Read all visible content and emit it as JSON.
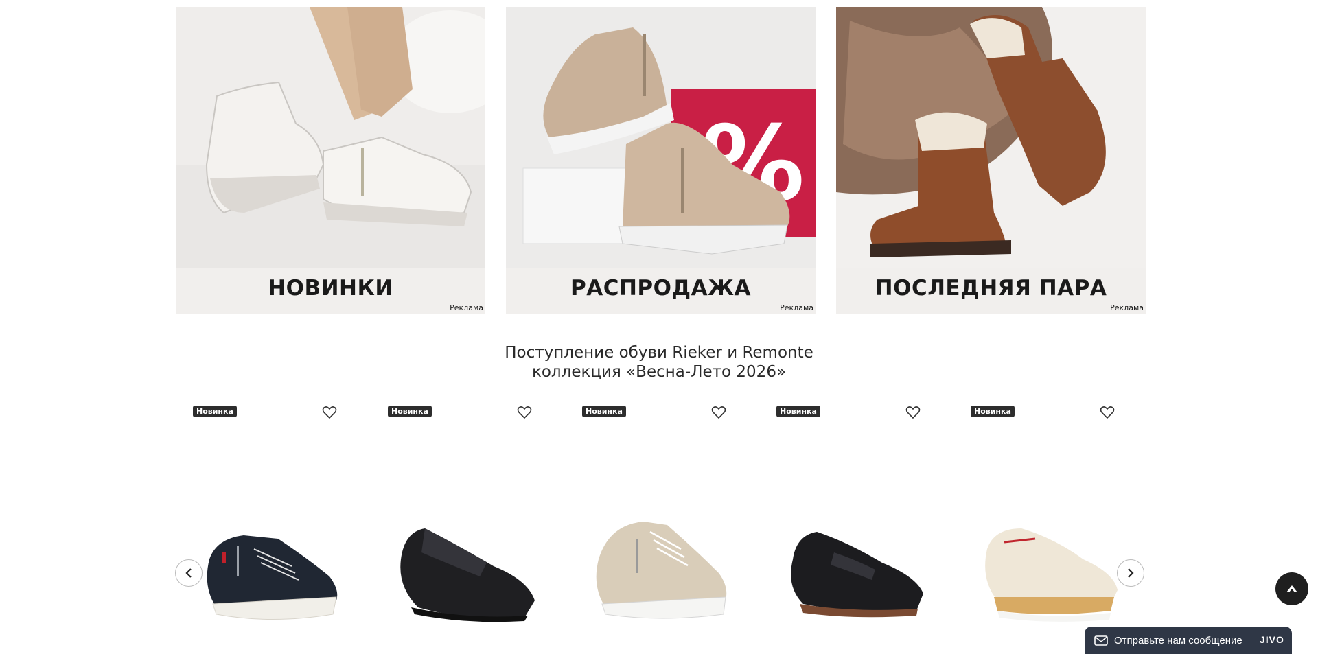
{
  "banners": [
    {
      "title": "НОВИНКИ",
      "ad_label": "Реклама"
    },
    {
      "title": "РАСПРОДАЖА",
      "ad_label": "Реклама"
    },
    {
      "title": "ПОСЛЕДНЯЯ ПАРА",
      "ad_label": "Реклама"
    }
  ],
  "section": {
    "title_line1": "Поступление обуви Rieker и Remonte",
    "title_line2": "коллекция «Весна-Лето 2026»"
  },
  "products": [
    {
      "badge": "Новинка",
      "icon": "heart-icon"
    },
    {
      "badge": "Новинка",
      "icon": "heart-icon"
    },
    {
      "badge": "Новинка",
      "icon": "heart-icon"
    },
    {
      "badge": "Новинка",
      "icon": "heart-icon"
    },
    {
      "badge": "Новинка",
      "icon": "heart-icon"
    }
  ],
  "chat": {
    "message": "Отправьте нам сообщение",
    "brand": "JIVO"
  },
  "colors": {
    "badge_bg": "#2d2d2d",
    "chat_bg": "#2f3746",
    "sale_red": "#c91f45"
  }
}
